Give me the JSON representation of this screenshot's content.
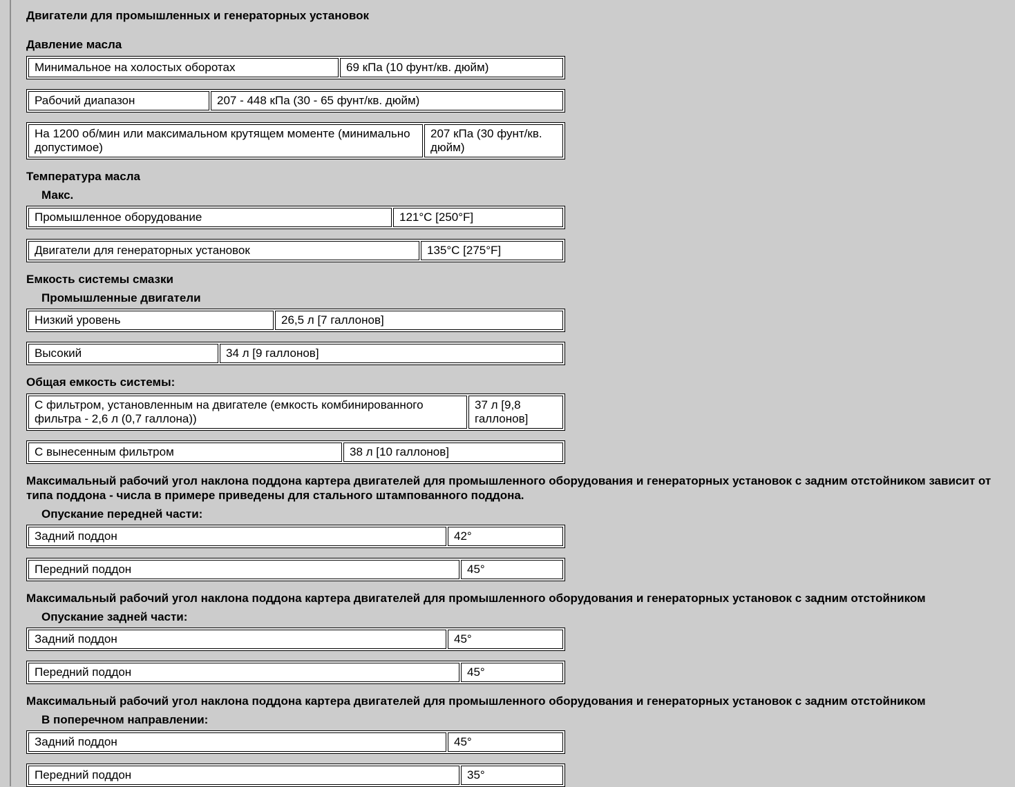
{
  "title": "Двигатели для промышленных и генераторных установок",
  "oil_pressure": {
    "heading": "Давление масла",
    "rows": [
      {
        "label": "Минимальное на холостых оборотах",
        "value": "69 кПа (10 фунт/кв. дюйм)"
      },
      {
        "label": "Рабочий диапазон",
        "value": "207 - 448 кПа (30 - 65 фунт/кв. дюйм)"
      },
      {
        "label": "На 1200 об/мин или максимальном крутящем моменте (минимально допустимое)",
        "value": "207 кПа (30 фунт/кв. дюйм)"
      }
    ]
  },
  "oil_temperature": {
    "heading": "Температура масла",
    "subheading": "Макс.",
    "rows": [
      {
        "label": "Промышленное оборудование",
        "value": "121°C [250°F]"
      },
      {
        "label": "Двигатели для генераторных установок",
        "value": "135°C [275°F]"
      }
    ]
  },
  "capacity": {
    "heading": "Емкость системы смазки",
    "subheading": "Промышленные двигатели",
    "rows": [
      {
        "label": "Низкий уровень",
        "value": "26,5 л [7 галлонов]"
      },
      {
        "label": "Высокий",
        "value": "34 л [9 галлонов]"
      }
    ]
  },
  "total_capacity": {
    "heading": "Общая емкость системы:",
    "rows": [
      {
        "label": "С фильтром, установленным на двигателе (емкость комбинированного фильтра - 2,6 л (0,7 галлона))",
        "value": "37 л [9,8 галлонов]"
      },
      {
        "label": "С вынесенным фильтром",
        "value": "38 л [10 галлонов]"
      }
    ]
  },
  "angle_front": {
    "heading": "Максимальный рабочий угол наклона поддона картера двигателей для промышленного оборудования и генераторных установок с задним отстойником зависит от типа поддона - числа в примере приведены для стального штампованного поддона.",
    "subheading": "Опускание передней части:",
    "rows": [
      {
        "label": "Задний поддон",
        "value": "42°"
      },
      {
        "label": "Передний поддон",
        "value": "45°"
      }
    ]
  },
  "angle_rear": {
    "heading": "Максимальный рабочий угол наклона поддона картера двигателей для промышленного оборудования и генераторных установок с задним отстойником",
    "subheading": "Опускание задней части:",
    "rows": [
      {
        "label": "Задний поддон",
        "value": "45°"
      },
      {
        "label": "Передний поддон",
        "value": "45°"
      }
    ]
  },
  "angle_side": {
    "heading": "Максимальный рабочий угол наклона поддона картера двигателей для промышленного оборудования и генераторных установок с задним отстойником",
    "subheading": "В поперечном направлении:",
    "rows": [
      {
        "label": "Задний поддон",
        "value": "45°"
      },
      {
        "label": "Передний поддон",
        "value": "35°"
      }
    ]
  }
}
